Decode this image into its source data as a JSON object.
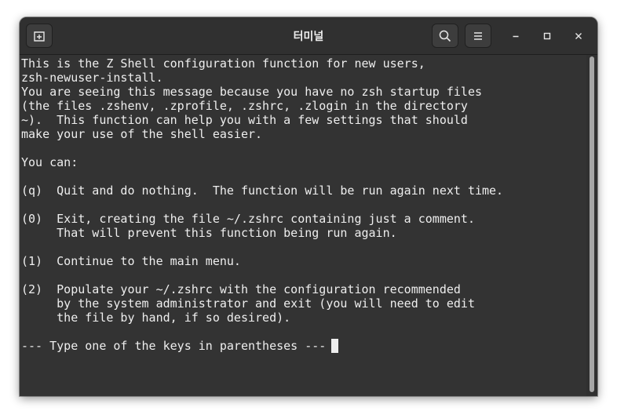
{
  "window": {
    "title": "터미널"
  },
  "headerbar": {
    "new_tab_icon": "new-tab-icon",
    "search_icon": "search-icon",
    "menu_icon": "hamburger-menu-icon",
    "minimize_icon": "minimize-icon",
    "maximize_icon": "maximize-icon",
    "close_icon": "close-icon"
  },
  "terminal": {
    "lines": [
      "This is the Z Shell configuration function for new users,",
      "zsh-newuser-install.",
      "You are seeing this message because you have no zsh startup files",
      "(the files .zshenv, .zprofile, .zshrc, .zlogin in the directory",
      "~).  This function can help you with a few settings that should",
      "make your use of the shell easier.",
      "",
      "You can:",
      "",
      "(q)  Quit and do nothing.  The function will be run again next time.",
      "",
      "(0)  Exit, creating the file ~/.zshrc containing just a comment.",
      "     That will prevent this function being run again.",
      "",
      "(1)  Continue to the main menu.",
      "",
      "(2)  Populate your ~/.zshrc with the configuration recommended",
      "     by the system administrator and exit (you will need to edit",
      "     the file by hand, if so desired).",
      "",
      "--- Type one of the keys in parentheses --- "
    ]
  },
  "colors": {
    "terminal_bg": "#333333",
    "terminal_fg": "#eeeeee",
    "headerbar_bg": "#303030"
  }
}
